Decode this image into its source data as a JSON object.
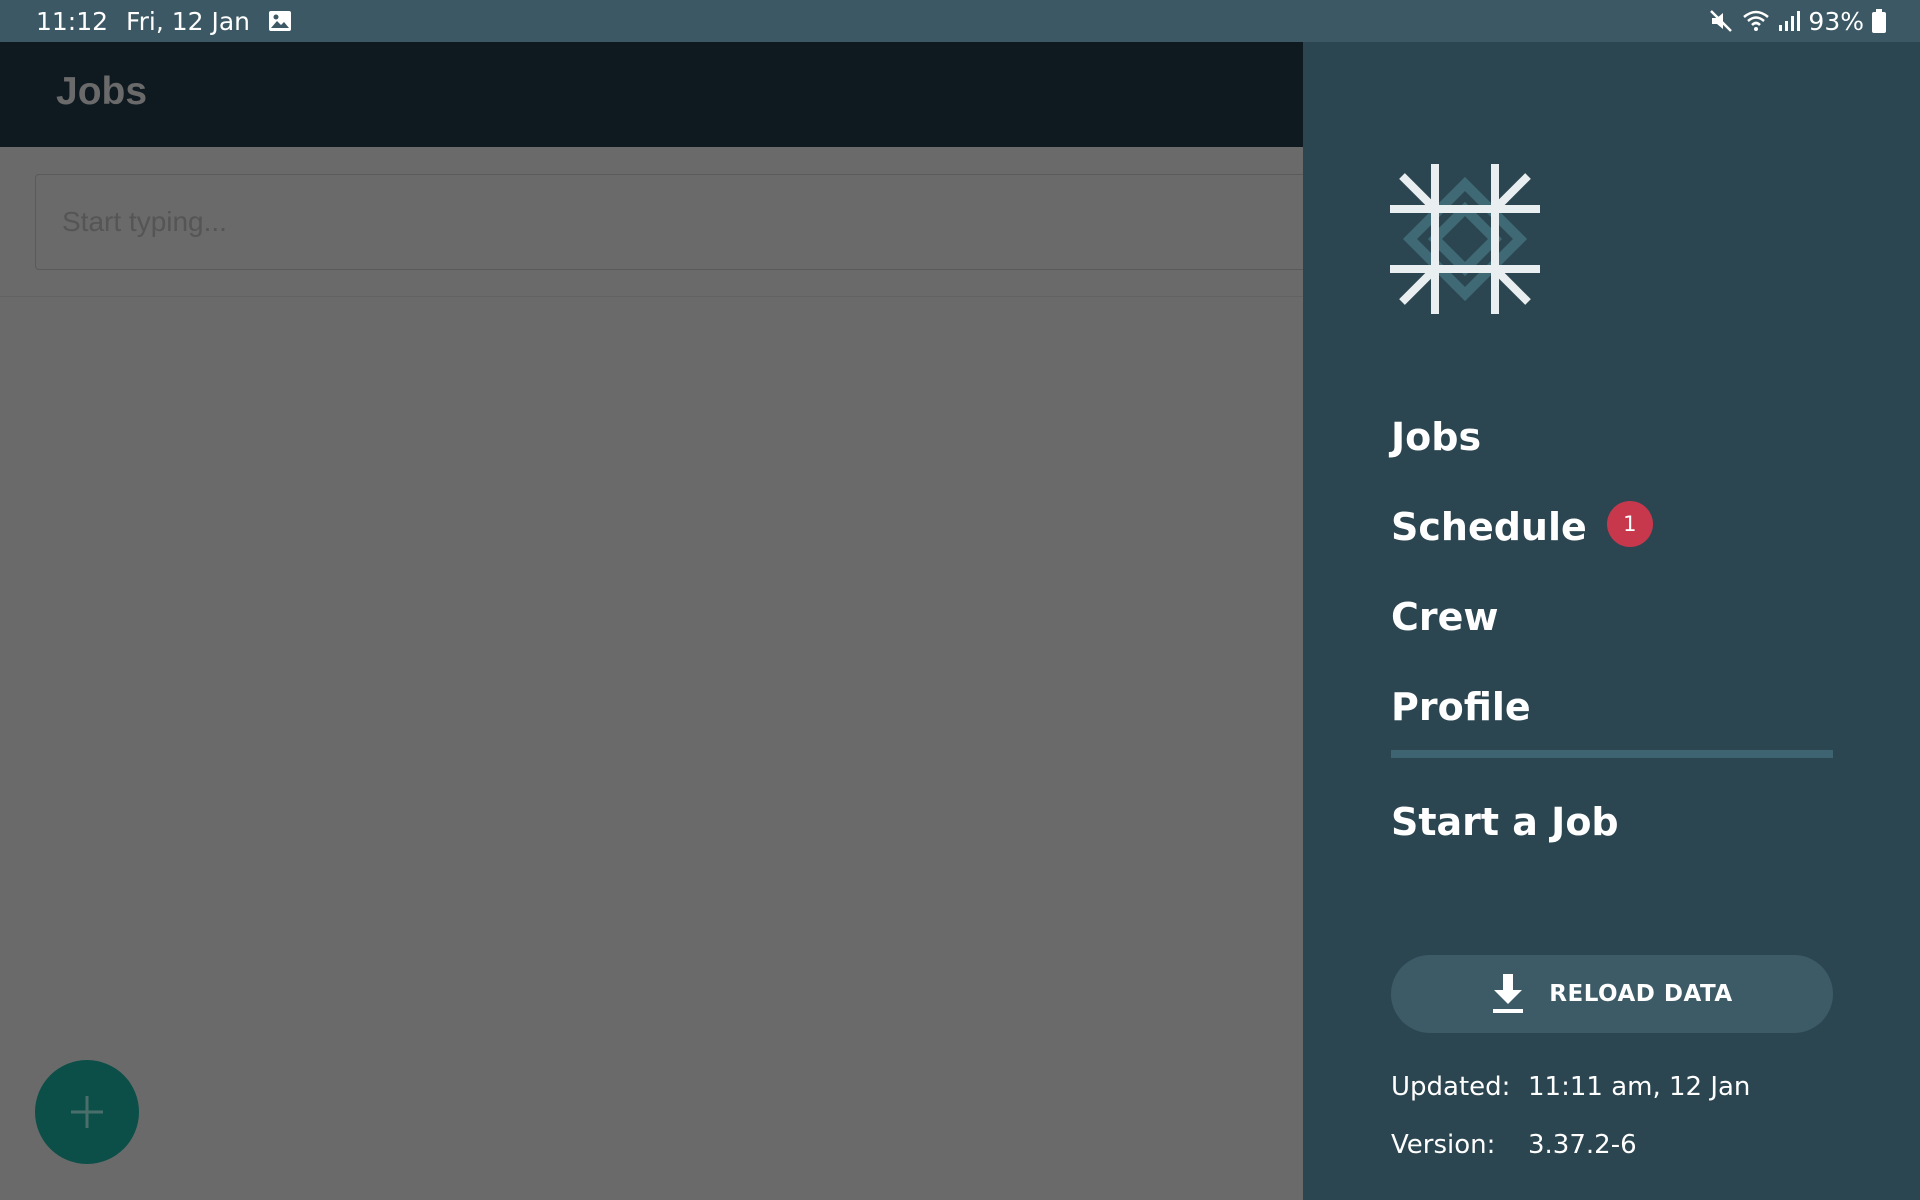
{
  "status_bar": {
    "time": "11:12",
    "date": "Fri, 12 Jan",
    "battery": "93%",
    "icons": [
      "gallery-icon",
      "mute-icon",
      "wifi-icon",
      "signal-icon",
      "battery-icon"
    ]
  },
  "app": {
    "title": "Jobs",
    "search_placeholder": "Start typing...",
    "fab_icon": "plus-icon"
  },
  "drawer": {
    "nav": [
      {
        "label": "Jobs"
      },
      {
        "label": "Schedule",
        "badge": "1"
      },
      {
        "label": "Crew"
      },
      {
        "label": "Profile"
      }
    ],
    "start_job": "Start a Job",
    "reload_label": "RELOAD DATA",
    "reload_icon": "download-icon",
    "updated_label": "Updated:",
    "updated_value": "11:11 am, 12 Jan",
    "version_label": "Version:",
    "version_value": "3.37.2-6"
  },
  "colors": {
    "status_bar": "#3b5864",
    "drawer": "#2b4651",
    "appbar": "#0f1a20",
    "scrim": "#6a6a6a",
    "badge": "#c8384c",
    "fab": "#0b4f48",
    "reload_button": "#3d5b67"
  }
}
